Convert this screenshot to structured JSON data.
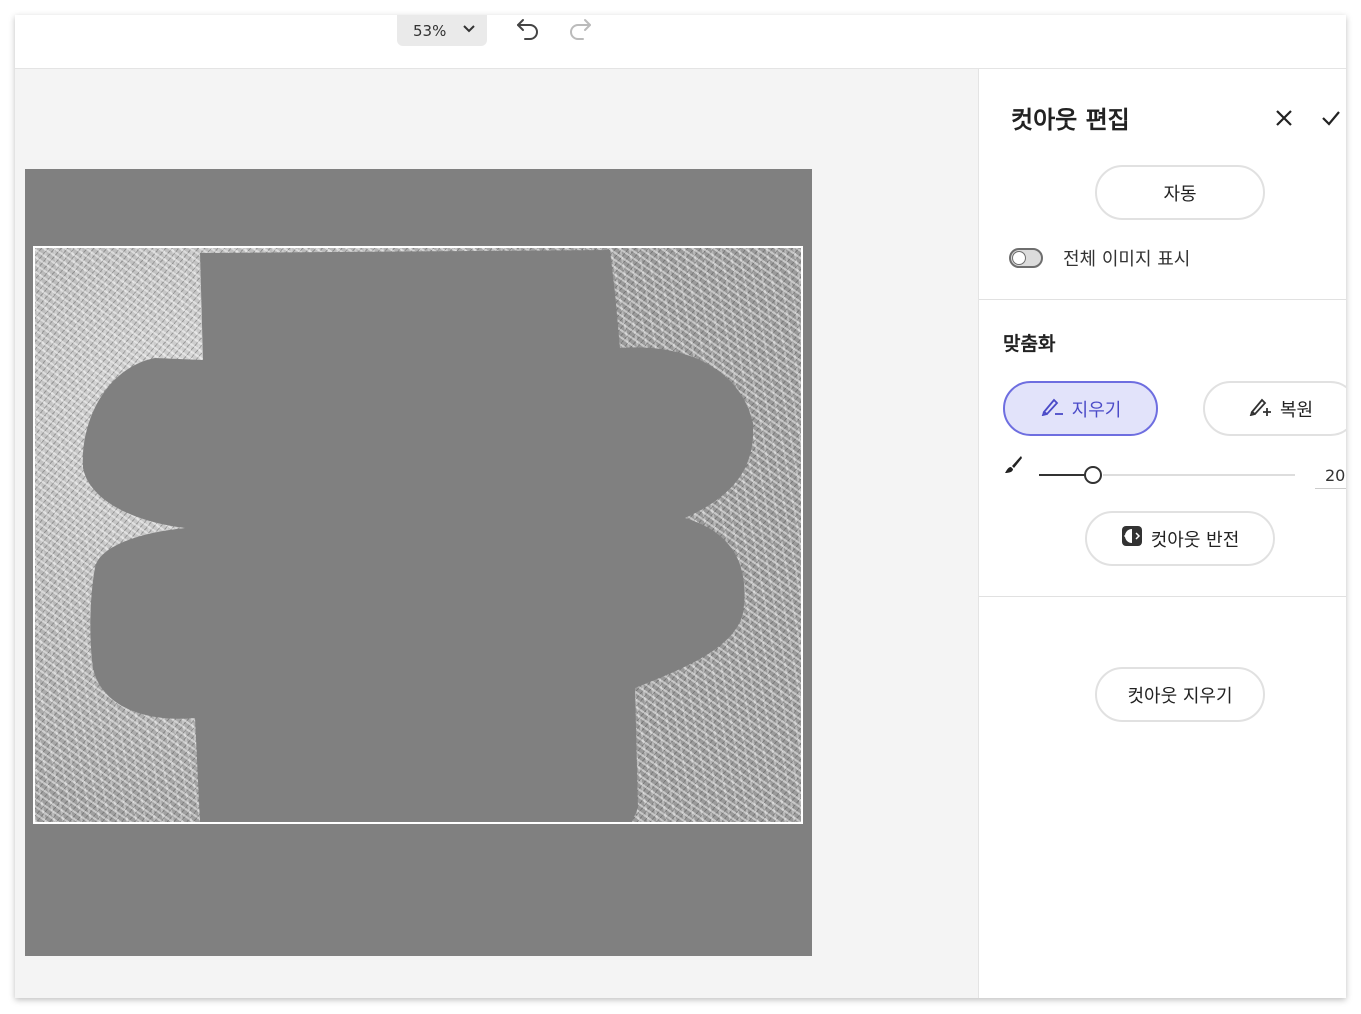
{
  "toolbar": {
    "zoom_value": "53%"
  },
  "panel": {
    "title": "컷아웃 편집",
    "auto_label": "자동",
    "show_full_image_label": "전체 이미지 표시",
    "show_full_image_on": false,
    "refine_section_title": "맞춤화",
    "erase_label": "지우기",
    "restore_label": "복원",
    "brush_size_value": "20",
    "brush_size_level": 20,
    "invert_label": "컷아웃 반전",
    "clear_label": "컷아웃 지우기"
  },
  "colors": {
    "accent": "#4b4bc8",
    "accent_bg": "#e2e3fa",
    "mask_gray": "#808080",
    "canvas_bg": "#f4f4f4"
  },
  "icons": {
    "zoom_dropdown": "chevron-down-icon",
    "undo": "undo-icon",
    "redo": "redo-icon",
    "close": "close-icon",
    "confirm": "checkmark-icon",
    "erase": "eraser-brush-icon",
    "restore": "restore-brush-icon",
    "brush": "brush-icon",
    "invert": "invert-icon"
  }
}
